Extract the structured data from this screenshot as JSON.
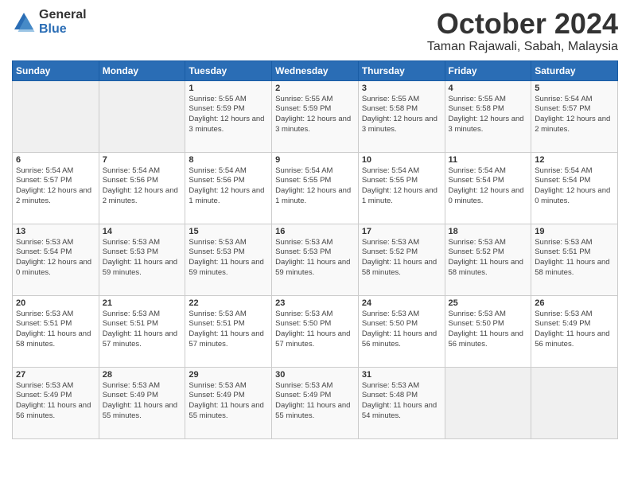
{
  "logo": {
    "general": "General",
    "blue": "Blue"
  },
  "header": {
    "month": "October 2024",
    "location": "Taman Rajawali, Sabah, Malaysia"
  },
  "weekdays": [
    "Sunday",
    "Monday",
    "Tuesday",
    "Wednesday",
    "Thursday",
    "Friday",
    "Saturday"
  ],
  "weeks": [
    [
      {
        "day": "",
        "content": ""
      },
      {
        "day": "",
        "content": ""
      },
      {
        "day": "1",
        "content": "Sunrise: 5:55 AM\nSunset: 5:59 PM\nDaylight: 12 hours and 3 minutes."
      },
      {
        "day": "2",
        "content": "Sunrise: 5:55 AM\nSunset: 5:59 PM\nDaylight: 12 hours and 3 minutes."
      },
      {
        "day": "3",
        "content": "Sunrise: 5:55 AM\nSunset: 5:58 PM\nDaylight: 12 hours and 3 minutes."
      },
      {
        "day": "4",
        "content": "Sunrise: 5:55 AM\nSunset: 5:58 PM\nDaylight: 12 hours and 3 minutes."
      },
      {
        "day": "5",
        "content": "Sunrise: 5:54 AM\nSunset: 5:57 PM\nDaylight: 12 hours and 2 minutes."
      }
    ],
    [
      {
        "day": "6",
        "content": "Sunrise: 5:54 AM\nSunset: 5:57 PM\nDaylight: 12 hours and 2 minutes."
      },
      {
        "day": "7",
        "content": "Sunrise: 5:54 AM\nSunset: 5:56 PM\nDaylight: 12 hours and 2 minutes."
      },
      {
        "day": "8",
        "content": "Sunrise: 5:54 AM\nSunset: 5:56 PM\nDaylight: 12 hours and 1 minute."
      },
      {
        "day": "9",
        "content": "Sunrise: 5:54 AM\nSunset: 5:55 PM\nDaylight: 12 hours and 1 minute."
      },
      {
        "day": "10",
        "content": "Sunrise: 5:54 AM\nSunset: 5:55 PM\nDaylight: 12 hours and 1 minute."
      },
      {
        "day": "11",
        "content": "Sunrise: 5:54 AM\nSunset: 5:54 PM\nDaylight: 12 hours and 0 minutes."
      },
      {
        "day": "12",
        "content": "Sunrise: 5:54 AM\nSunset: 5:54 PM\nDaylight: 12 hours and 0 minutes."
      }
    ],
    [
      {
        "day": "13",
        "content": "Sunrise: 5:53 AM\nSunset: 5:54 PM\nDaylight: 12 hours and 0 minutes."
      },
      {
        "day": "14",
        "content": "Sunrise: 5:53 AM\nSunset: 5:53 PM\nDaylight: 11 hours and 59 minutes."
      },
      {
        "day": "15",
        "content": "Sunrise: 5:53 AM\nSunset: 5:53 PM\nDaylight: 11 hours and 59 minutes."
      },
      {
        "day": "16",
        "content": "Sunrise: 5:53 AM\nSunset: 5:53 PM\nDaylight: 11 hours and 59 minutes."
      },
      {
        "day": "17",
        "content": "Sunrise: 5:53 AM\nSunset: 5:52 PM\nDaylight: 11 hours and 58 minutes."
      },
      {
        "day": "18",
        "content": "Sunrise: 5:53 AM\nSunset: 5:52 PM\nDaylight: 11 hours and 58 minutes."
      },
      {
        "day": "19",
        "content": "Sunrise: 5:53 AM\nSunset: 5:51 PM\nDaylight: 11 hours and 58 minutes."
      }
    ],
    [
      {
        "day": "20",
        "content": "Sunrise: 5:53 AM\nSunset: 5:51 PM\nDaylight: 11 hours and 58 minutes."
      },
      {
        "day": "21",
        "content": "Sunrise: 5:53 AM\nSunset: 5:51 PM\nDaylight: 11 hours and 57 minutes."
      },
      {
        "day": "22",
        "content": "Sunrise: 5:53 AM\nSunset: 5:51 PM\nDaylight: 11 hours and 57 minutes."
      },
      {
        "day": "23",
        "content": "Sunrise: 5:53 AM\nSunset: 5:50 PM\nDaylight: 11 hours and 57 minutes."
      },
      {
        "day": "24",
        "content": "Sunrise: 5:53 AM\nSunset: 5:50 PM\nDaylight: 11 hours and 56 minutes."
      },
      {
        "day": "25",
        "content": "Sunrise: 5:53 AM\nSunset: 5:50 PM\nDaylight: 11 hours and 56 minutes."
      },
      {
        "day": "26",
        "content": "Sunrise: 5:53 AM\nSunset: 5:49 PM\nDaylight: 11 hours and 56 minutes."
      }
    ],
    [
      {
        "day": "27",
        "content": "Sunrise: 5:53 AM\nSunset: 5:49 PM\nDaylight: 11 hours and 56 minutes."
      },
      {
        "day": "28",
        "content": "Sunrise: 5:53 AM\nSunset: 5:49 PM\nDaylight: 11 hours and 55 minutes."
      },
      {
        "day": "29",
        "content": "Sunrise: 5:53 AM\nSunset: 5:49 PM\nDaylight: 11 hours and 55 minutes."
      },
      {
        "day": "30",
        "content": "Sunrise: 5:53 AM\nSunset: 5:49 PM\nDaylight: 11 hours and 55 minutes."
      },
      {
        "day": "31",
        "content": "Sunrise: 5:53 AM\nSunset: 5:48 PM\nDaylight: 11 hours and 54 minutes."
      },
      {
        "day": "",
        "content": ""
      },
      {
        "day": "",
        "content": ""
      }
    ]
  ]
}
